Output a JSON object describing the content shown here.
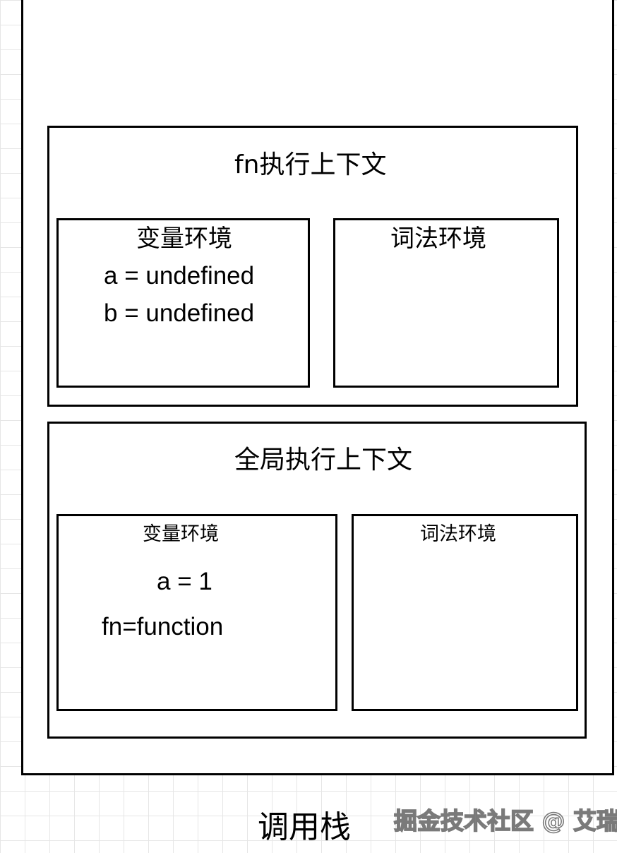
{
  "call_stack": {
    "label": "调用栈"
  },
  "fn_context": {
    "title": "fn执行上下文",
    "variable_env": {
      "title": "变量环境",
      "entries": [
        "a = undefined",
        "b = undefined"
      ]
    },
    "lexical_env": {
      "title": "词法环境"
    }
  },
  "global_context": {
    "title": "全局执行上下文",
    "variable_env": {
      "title": "变量环境",
      "entries": [
        "a = 1",
        "fn=function"
      ]
    },
    "lexical_env": {
      "title": "词法环境"
    }
  },
  "watermark": "掘金技术社区 @ 艾瑞"
}
